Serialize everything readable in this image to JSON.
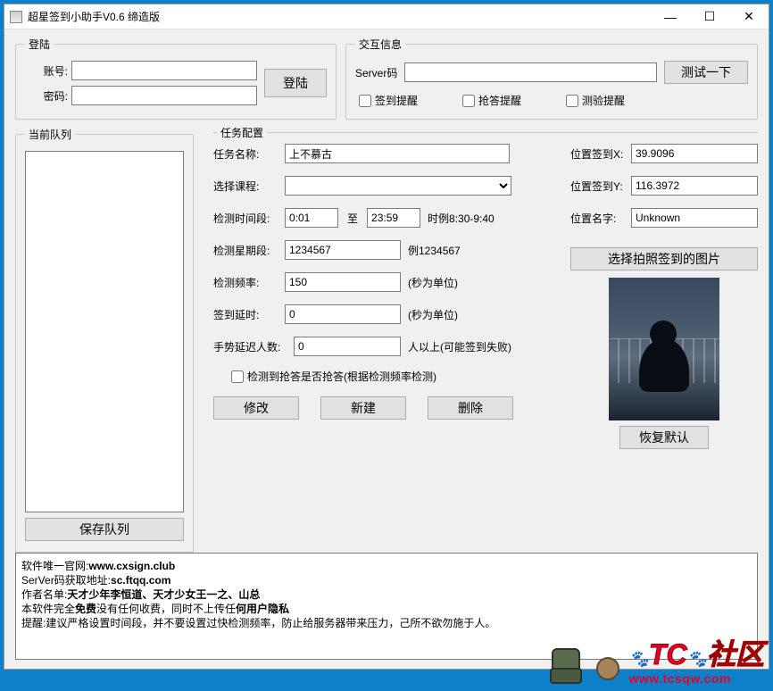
{
  "window": {
    "title": "超星签到小助手V0.6 缔造版"
  },
  "login": {
    "legend": "登陆",
    "account_label": "账号:",
    "password_label": "密码:",
    "button": "登陆"
  },
  "interaction": {
    "legend": "交互信息",
    "server_label": "Server码",
    "test_button": "测试一下",
    "chk_signin": "签到提醒",
    "chk_quiz": "抢答提醒",
    "chk_test": "测验提醒"
  },
  "queue": {
    "legend": "当前队列",
    "save_button": "保存队列"
  },
  "task": {
    "legend": "任务配置",
    "name_label": "任务名称:",
    "name_value": "上不慕古",
    "course_label": "选择课程:",
    "time_label": "检测时间段:",
    "time_from": "0:01",
    "time_to_label": "至",
    "time_to": "23:59",
    "time_hint": "时例8:30-9:40",
    "week_label": "检测星期段:",
    "week_value": "1234567",
    "week_hint": "例1234567",
    "freq_label": "检测频率:",
    "freq_value": "150",
    "freq_hint": "(秒为单位)",
    "delay_label": "签到延时:",
    "delay_value": "0",
    "delay_hint": "(秒为单位)",
    "gesture_label": "手势延迟人数:",
    "gesture_value": "0",
    "gesture_hint": "人以上(可能签到失败)",
    "chk_quiz_detect": "检测到抢答是否抢答(根据检测频率检测)",
    "btn_modify": "修改",
    "btn_new": "新建",
    "btn_delete": "删除"
  },
  "location": {
    "x_label": "位置签到X:",
    "x_value": "39.9096",
    "y_label": "位置签到Y:",
    "y_value": "116.3972",
    "name_label": "位置名字:",
    "name_value": "Unknown",
    "pick_button": "选择拍照签到的图片",
    "restore_button": "恢复默认"
  },
  "info": {
    "l1a": "软件唯一官网:",
    "l1b": "www.cxsign.club",
    "l2a": "SerVer码获取地址:",
    "l2b": "sc.ftqq.com",
    "l3a": "作者名单:",
    "l3b": "天才少年李恒道、天才少女王一之、山总",
    "l4a": "本软件完全",
    "l4b": "免费",
    "l4c": "没有任何收费，同时不上传任",
    "l4d": "何用户隐私",
    "l5": "提醒:建议严格设置时间段，并不要设置过快检测频率，防止给服务器带来压力，己所不欲勿施于人。"
  },
  "watermark": {
    "brand": "TC",
    "brand2": "社区",
    "url": "www.tcsqw.com"
  }
}
